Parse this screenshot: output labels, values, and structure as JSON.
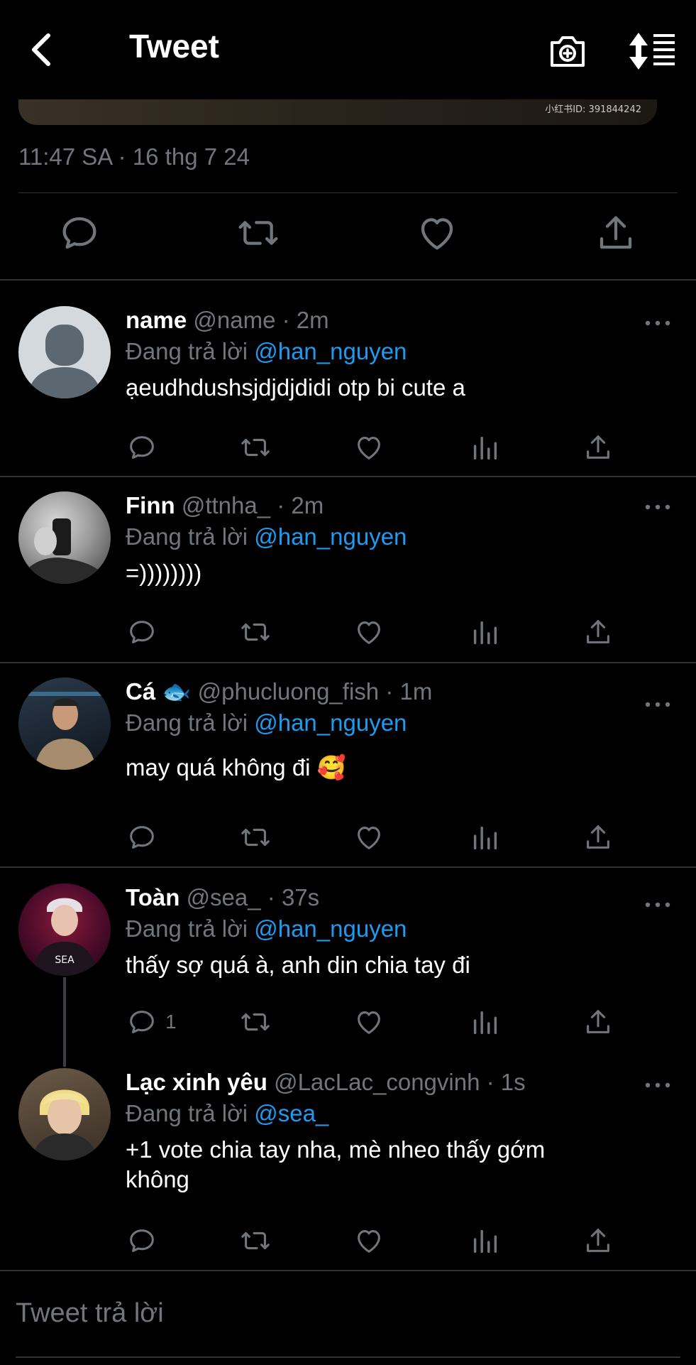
{
  "header": {
    "title": "Tweet"
  },
  "tweet": {
    "image_watermark": "小红书ID: 391844242",
    "timestamp": "11:47 SA · 16 thg 7 24"
  },
  "replies": [
    {
      "name": "name",
      "handle": "@name",
      "time": "· 2m",
      "replying_prefix": "Đang trả lời",
      "replying_to": "@han_nguyen",
      "text": "ạeudhdushsjdjdjdidi otp bi cute a",
      "reply_count": ""
    },
    {
      "name": "Finn",
      "handle": "@ttnha_",
      "time": "· 2m",
      "replying_prefix": "Đang trả lời",
      "replying_to": "@han_nguyen",
      "text": "=))))))))",
      "reply_count": ""
    },
    {
      "name": "Cá 🐟",
      "handle": "@phucluong_fish",
      "time": "· 1m",
      "replying_prefix": "Đang trả lời",
      "replying_to": "@han_nguyen",
      "text": "may quá không đi 🥰",
      "reply_count": ""
    },
    {
      "name": "Toàn",
      "handle": "@sea_",
      "time": "· 37s",
      "replying_prefix": "Đang trả lời",
      "replying_to": "@han_nguyen",
      "text": "thấy sợ quá à, anh din chia tay đi",
      "reply_count": "1"
    },
    {
      "name": "Lạc xinh yêu",
      "handle": "@LacLac_congvinh",
      "time": "· 1s",
      "replying_prefix": "Đang trả lời",
      "replying_to": "@sea_",
      "text": "+1 vote chia tay nha, mè nheo thấy gớm không",
      "reply_count": ""
    }
  ],
  "composer": {
    "placeholder": "Tweet trả lời"
  },
  "colors": {
    "background": "#000000",
    "accent": "#1d9bf0",
    "secondary_text": "#71767b",
    "divider": "#2f3336"
  },
  "icons": [
    "back-arrow-icon",
    "camera-plus-icon",
    "sort-icon",
    "reply-icon",
    "retweet-icon",
    "like-icon",
    "views-icon",
    "share-icon",
    "more-icon"
  ]
}
